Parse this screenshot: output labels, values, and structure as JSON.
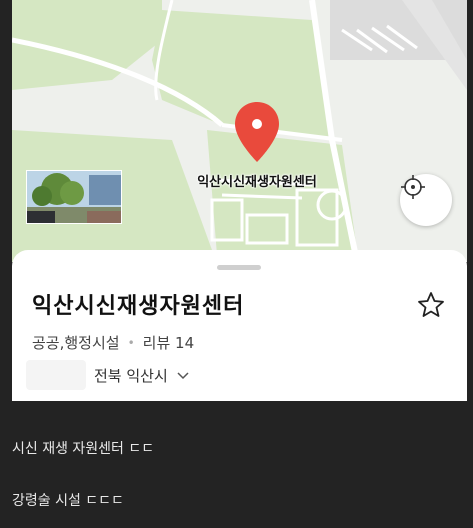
{
  "map": {
    "pin_label": "익산시신재생자원센터",
    "pin_icon": "map-pin-icon",
    "locate_icon": "crosshair-icon",
    "colors": {
      "park": "#d5e7c2",
      "road": "#ffffff",
      "pin": "#e94a3c",
      "background": "#eef0ec"
    }
  },
  "place": {
    "name": "익산시신재생자원센터",
    "category": "공공,행정시설",
    "separator": "•",
    "reviews": "리뷰 14",
    "address": "전북 익산시",
    "favorite_icon": "star-outline-icon",
    "expand_icon": "chevron-down-icon"
  },
  "comments": [
    {
      "text": "시신 재생 자원센터 ㄷㄷ"
    },
    {
      "text": "강령술 시설 ㄷㄷㄷ"
    }
  ]
}
